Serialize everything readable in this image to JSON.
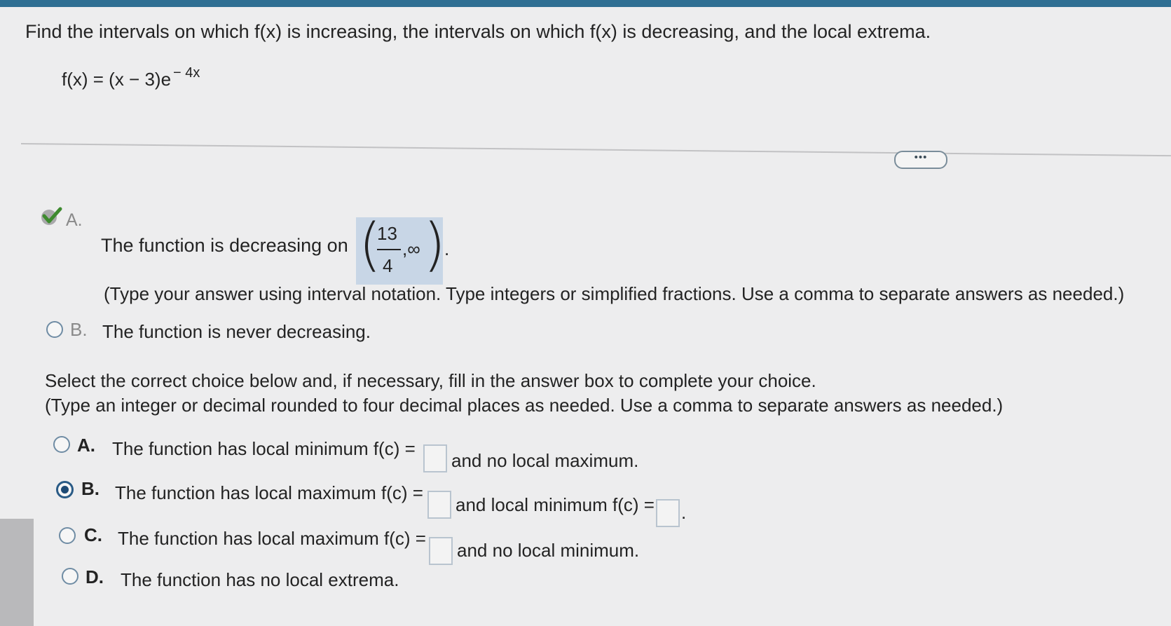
{
  "question": {
    "prompt": "Find the intervals on which f(x) is increasing, the intervals on which f(x) is decreasing, and the local extrema.",
    "function_base": "f(x) = (x − 3)e",
    "function_exp": "− 4x"
  },
  "more_button": "•••",
  "part_decreasing": {
    "choice_a_letter": "A.",
    "choice_a_text": "The function is decreasing on",
    "answer_numerator": "13",
    "answer_denominator": "4",
    "answer_tail": ",∞",
    "answer_period": ".",
    "instructions": "(Type your answer using interval notation. Type integers or simplified fractions. Use a comma to separate answers as needed.)",
    "choice_b_letter": "B.",
    "choice_b_text": "The function is never decreasing."
  },
  "part_extrema": {
    "instruction_line1": "Select the correct choice below and, if necessary, fill in the answer box to complete your choice.",
    "instruction_line2": "(Type an integer or decimal rounded to four decimal places as needed. Use a comma to separate answers as needed.)",
    "choices": [
      {
        "letter": "A.",
        "text1": "The function has local minimum f(c) =",
        "text2": "and no local maximum.",
        "selected": false
      },
      {
        "letter": "B.",
        "text1": "The function has local maximum f(c) =",
        "text2": "and local minimum f(c) =",
        "text3": ".",
        "selected": true
      },
      {
        "letter": "C.",
        "text1": "The function has local maximum f(c) =",
        "text2": "and no local minimum.",
        "selected": false
      },
      {
        "letter": "D.",
        "text1": "The function has no local extrema.",
        "selected": false
      }
    ]
  }
}
